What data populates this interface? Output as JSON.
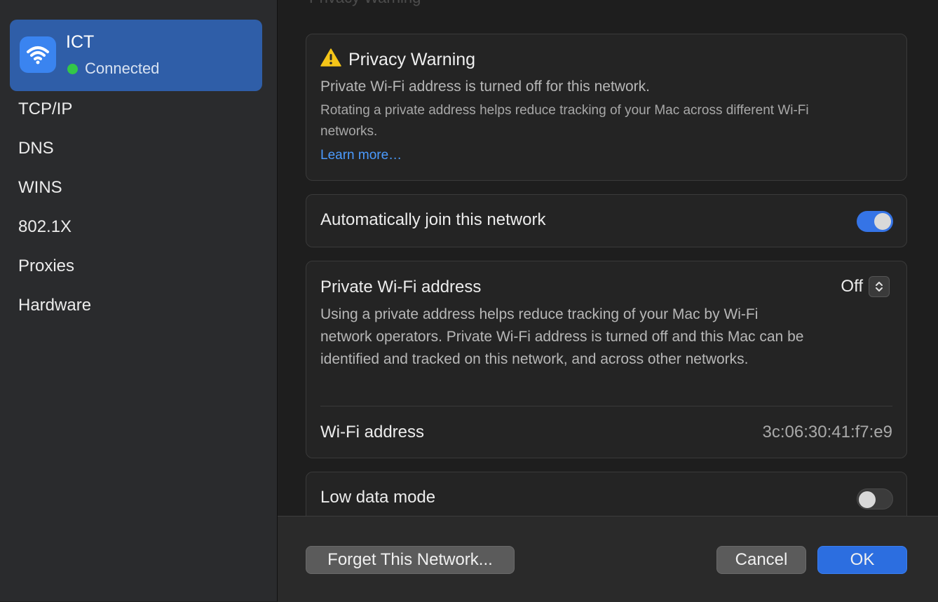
{
  "sidebar": {
    "network": {
      "name": "ICT",
      "status": "Connected",
      "icon": "wifi-icon"
    },
    "items": [
      {
        "label": "TCP/IP"
      },
      {
        "label": "DNS"
      },
      {
        "label": "WINS"
      },
      {
        "label": "802.1X"
      },
      {
        "label": "Proxies"
      },
      {
        "label": "Hardware"
      }
    ]
  },
  "main": {
    "ghost_header": "Privacy Warning",
    "privacy_warning": {
      "icon": "warning-icon",
      "title": "Privacy Warning",
      "line1": "Private Wi-Fi address is turned off for this network.",
      "line2": "Rotating a private address helps reduce tracking of your Mac across different Wi-Fi networks.",
      "link": "Learn more…"
    },
    "auto_join": {
      "label": "Automatically join this network",
      "enabled": true
    },
    "private_address": {
      "label": "Private Wi-Fi address",
      "value": "Off",
      "description": "Using a private address helps reduce tracking of your Mac by Wi-Fi network operators. Private Wi-Fi address is turned off and this Mac can be identified and tracked on this network, and across other networks."
    },
    "wifi_address": {
      "label": "Wi-Fi address",
      "value": "3c:06:30:41:f7:e9"
    },
    "low_data_mode": {
      "label": "Low data mode",
      "enabled": false
    }
  },
  "footer": {
    "forget_label": "Forget This Network...",
    "cancel_label": "Cancel",
    "ok_label": "OK"
  },
  "colors": {
    "accent": "#3574e6",
    "selection": "#2f5ea8",
    "status_green": "#33c748",
    "warning_yellow": "#f5c518",
    "link": "#4b9bff"
  }
}
